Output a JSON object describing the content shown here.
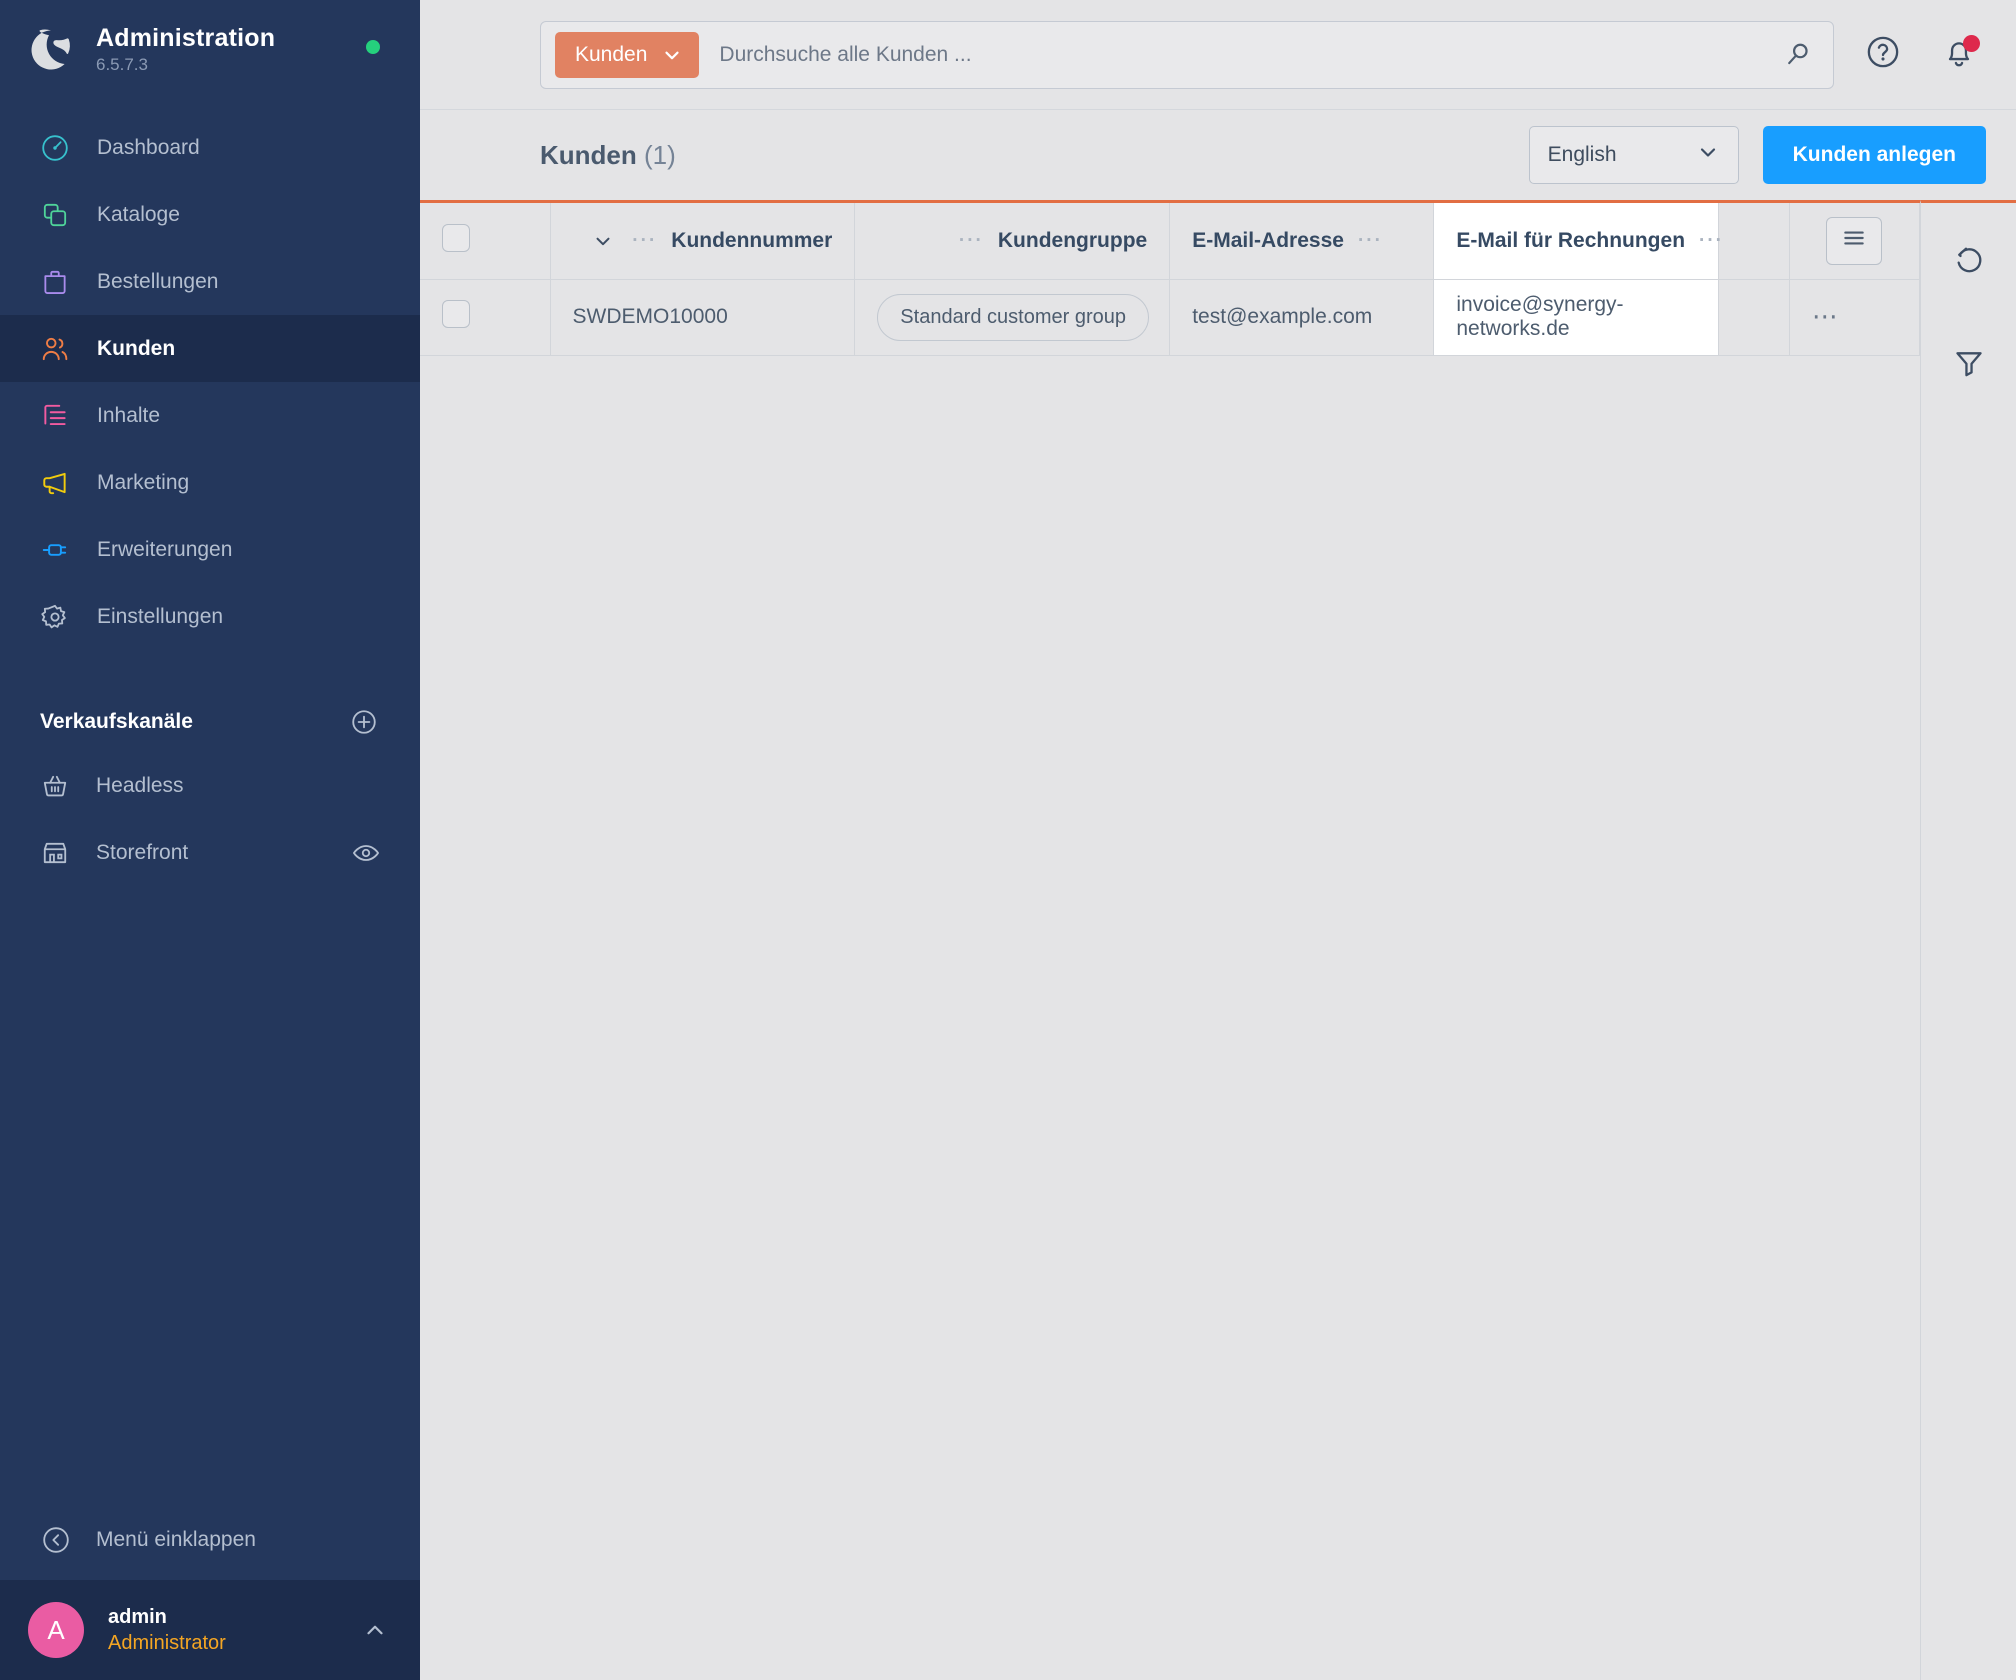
{
  "sidebar": {
    "brand": {
      "title": "Administration",
      "version": "6.5.7.3",
      "status_color": "#25d07d"
    },
    "nav_items": [
      {
        "label": "Dashboard",
        "icon": "dashboard-icon",
        "color": "#37c1cd",
        "active": false
      },
      {
        "label": "Kataloge",
        "icon": "catalog-icon",
        "color": "#4fd49a",
        "active": false
      },
      {
        "label": "Bestellungen",
        "icon": "orders-bag-icon",
        "color": "#a98bec",
        "active": false
      },
      {
        "label": "Kunden",
        "icon": "customers-icon",
        "color": "#ef7d45",
        "active": true
      },
      {
        "label": "Inhalte",
        "icon": "content-icon",
        "color": "#f25ba0",
        "active": false
      },
      {
        "label": "Marketing",
        "icon": "megaphone-icon",
        "color": "#f2cc0d",
        "active": false
      },
      {
        "label": "Erweiterungen",
        "icon": "plug-icon",
        "color": "#189eff",
        "active": false
      },
      {
        "label": "Einstellungen",
        "icon": "gear-icon",
        "color": "#b4bfd0",
        "active": false
      }
    ],
    "sales_channels": {
      "title": "Verkaufskanäle",
      "add_icon": "plus-circle-icon",
      "items": [
        {
          "label": "Headless",
          "icon": "basket-icon",
          "has_eye": false
        },
        {
          "label": "Storefront",
          "icon": "storefront-icon",
          "has_eye": true,
          "eye_icon": "eye-icon"
        }
      ]
    },
    "collapse": {
      "label": "Menü einklappen",
      "icon": "chevron-left-circle-icon"
    },
    "user": {
      "initial": "A",
      "name": "admin",
      "role": "Administrator",
      "caret_icon": "chevron-up-icon",
      "avatar_color": "#ea5ca3",
      "role_color": "#f5a623"
    }
  },
  "topbar": {
    "search": {
      "scope_label": "Kunden",
      "scope_caret_icon": "chevron-down-icon",
      "placeholder": "Durchsuche alle Kunden ...",
      "value": "",
      "search_icon": "search-icon"
    },
    "help_icon": "question-circle-icon",
    "notifications_icon": "bell-icon",
    "notification_dot_color": "#de294c"
  },
  "page": {
    "title_main": "Kunden",
    "title_count": "(1)",
    "language": {
      "value": "English",
      "caret_icon": "chevron-down-icon"
    },
    "create_button": "Kunden anlegen",
    "accent_color": "#e26e43",
    "primary_color": "#189eff"
  },
  "grid": {
    "columns": [
      {
        "key": "check",
        "label": "",
        "type": "checkbox"
      },
      {
        "key": "number",
        "label": "Kundennummer",
        "sorted": true,
        "sort_icon": "chevron-down-icon",
        "menu": "···"
      },
      {
        "key": "group",
        "label": "Kundengruppe",
        "menu": "···"
      },
      {
        "key": "email",
        "label": "E-Mail-Adresse",
        "menu": "···"
      },
      {
        "key": "invoice_email",
        "label": "E-Mail für Rechnungen",
        "menu": "···",
        "highlighted": true
      },
      {
        "key": "pad",
        "label": ""
      },
      {
        "key": "actions",
        "label": "",
        "type": "settings",
        "icon": "list-settings-icon"
      }
    ],
    "rows": [
      {
        "number": "SWDEMO10000",
        "group": "Standard customer group",
        "email": "test@example.com",
        "invoice_email": "invoice@synergy-networks.de",
        "actions_icon": "context-menu-icon"
      }
    ]
  },
  "right_rail": {
    "buttons": [
      {
        "name": "refresh-button",
        "icon": "refresh-icon"
      },
      {
        "name": "filter-button",
        "icon": "filter-funnel-icon"
      }
    ]
  }
}
